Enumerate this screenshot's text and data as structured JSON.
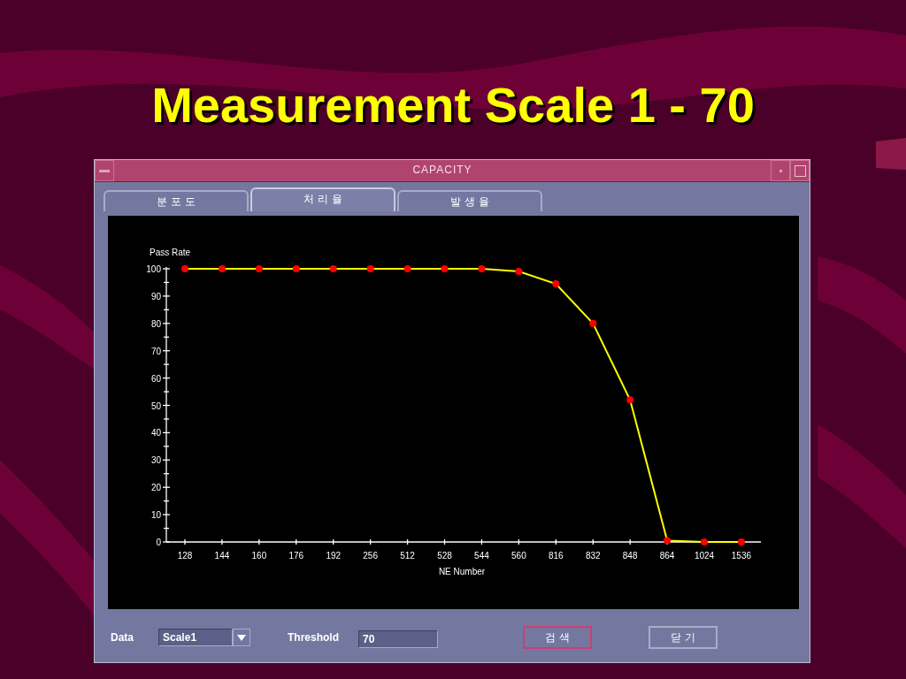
{
  "slide": {
    "title": "Measurement Scale 1 - 70"
  },
  "window": {
    "title": "CAPACITY"
  },
  "tabs": [
    {
      "label": "분 포 도",
      "selected": false
    },
    {
      "label": "처 리 율",
      "selected": true
    },
    {
      "label": "발 생 율",
      "selected": false
    }
  ],
  "chart_data": {
    "type": "line",
    "ylabel": "Pass Rate",
    "xlabel": "NE Number",
    "categories": [
      "128",
      "144",
      "160",
      "176",
      "192",
      "256",
      "512",
      "528",
      "544",
      "560",
      "816",
      "832",
      "848",
      "864",
      "1024",
      "1536"
    ],
    "values": [
      100,
      100,
      100,
      100,
      100,
      100,
      100,
      100,
      100,
      99,
      94.5,
      80,
      52,
      0.5,
      0,
      0
    ],
    "marker": "circle",
    "ylim": [
      0,
      100
    ],
    "yticks": [
      0,
      10,
      20,
      30,
      40,
      50,
      60,
      70,
      80,
      90,
      100
    ]
  },
  "controls": {
    "data_label": "Data",
    "data_value": "Scale1",
    "threshold_label": "Threshold",
    "threshold_value": "70"
  },
  "buttons": [
    {
      "label": "검 색",
      "focused": true
    },
    {
      "label": "닫 기",
      "focused": false
    }
  ]
}
